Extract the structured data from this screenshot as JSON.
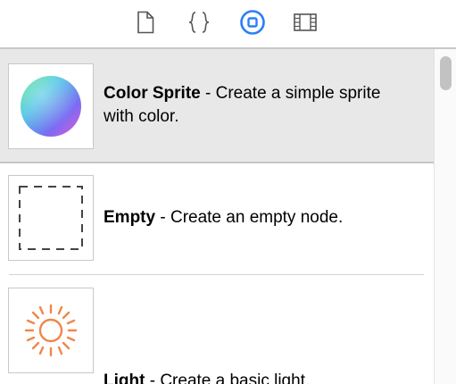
{
  "toolbar": {
    "icons": [
      "file-icon",
      "braces-icon",
      "object-library-icon",
      "media-library-icon"
    ],
    "accent_color": "#2d7ef7"
  },
  "items": [
    {
      "name": "Color Sprite",
      "separator": " - ",
      "description": "Create a simple sprite with color.",
      "icon": "color-sphere-icon"
    },
    {
      "name": "Empty",
      "separator": " - ",
      "description": "Create an empty node.",
      "icon": "empty-node-icon"
    },
    {
      "name": "Light",
      "separator": " - ",
      "description": "Create a basic light.",
      "icon": "sun-icon"
    }
  ],
  "colors": {
    "selected_row": "#e8e8e8",
    "sun": "#f0874a"
  }
}
